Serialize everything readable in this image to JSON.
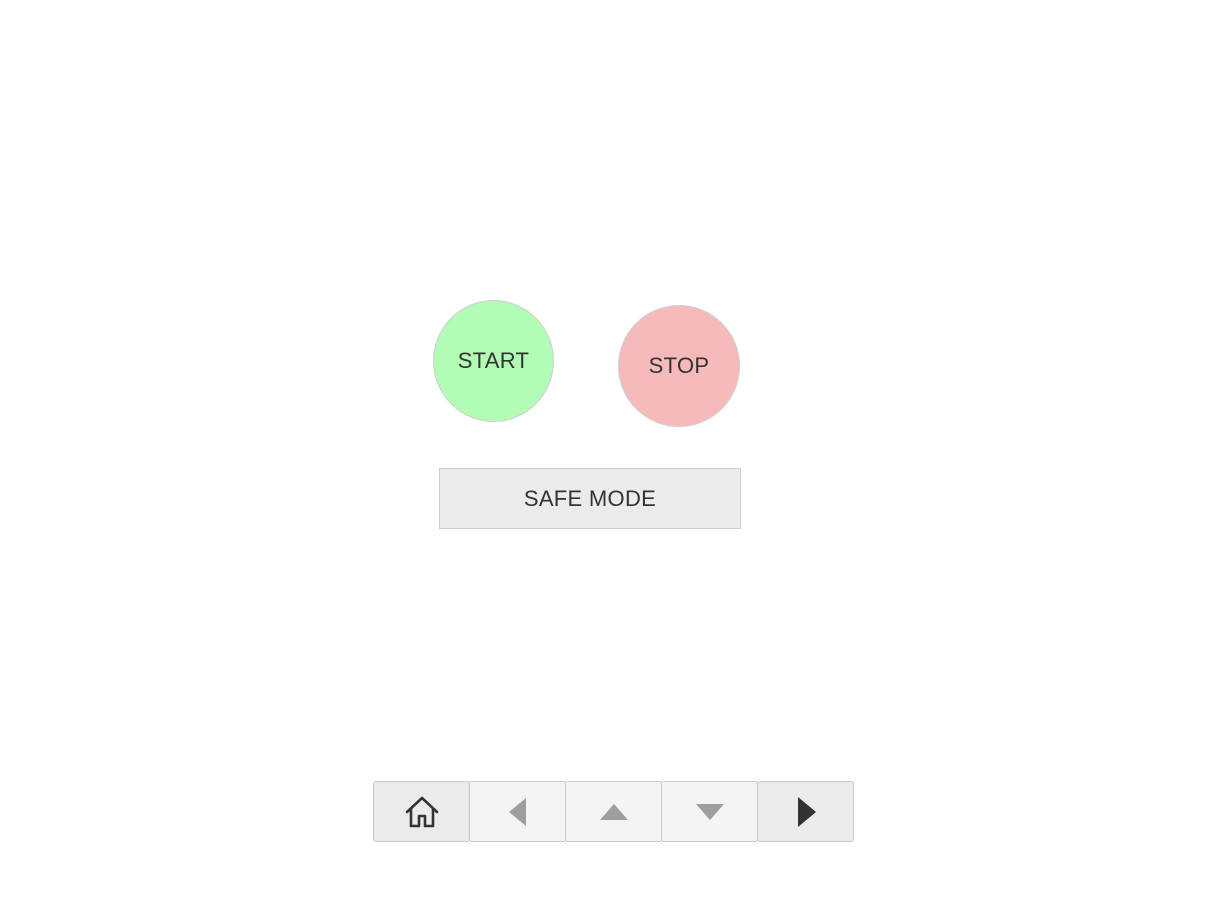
{
  "controls": {
    "start_label": "START",
    "stop_label": "STOP",
    "safe_mode_label": "SAFE MODE"
  },
  "colors": {
    "start_bg": "#b3fcb5",
    "stop_bg": "#f7baba",
    "safe_mode_bg": "#ebebeb",
    "icon_dark": "#333333",
    "icon_muted": "#9e9e9e"
  },
  "navigation": {
    "buttons": [
      {
        "icon": "home-icon"
      },
      {
        "icon": "arrow-left-icon"
      },
      {
        "icon": "arrow-up-icon"
      },
      {
        "icon": "arrow-down-icon"
      },
      {
        "icon": "arrow-right-icon"
      }
    ]
  }
}
